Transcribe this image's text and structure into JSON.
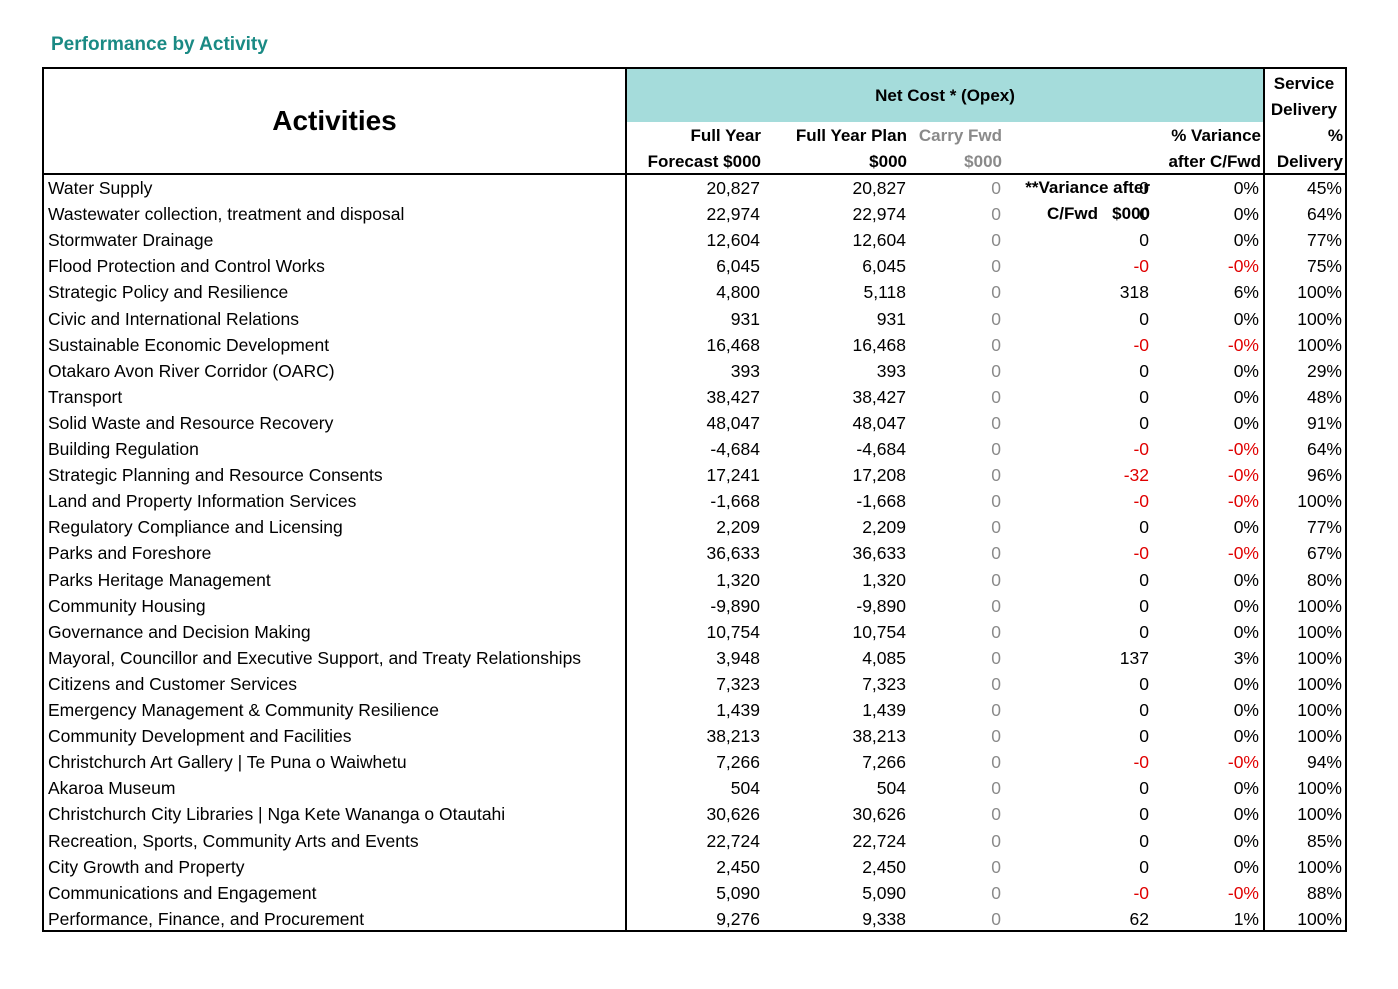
{
  "title": "Performance by Activity",
  "header": {
    "activities": "Activities",
    "net_cost": "Net Cost * (Opex)",
    "service_delivery": [
      "Service",
      "Delivery"
    ],
    "cols": [
      {
        "l1": "Full Year",
        "l2": "Forecast $000"
      },
      {
        "l1": "Full Year Plan",
        "l2": "$000"
      },
      {
        "l1": "Carry Fwd",
        "l2": "$000"
      },
      {
        "l1": "**Variance after",
        "l2": "C/Fwd   $000"
      },
      {
        "l1": "% Variance",
        "l2": "after C/Fwd"
      },
      {
        "l1": "%",
        "l2": "Delivery"
      }
    ]
  },
  "colors": {
    "title": "#1a8a84",
    "header_fill": "#a5dcdb",
    "negative": "#e00000",
    "muted": "#8a8a8a"
  },
  "rows": [
    {
      "name": "Water Supply",
      "forecast": "20,827",
      "plan": "20,827",
      "carry": "0",
      "variance": "0",
      "pct_var": "0%",
      "delivery": "45%"
    },
    {
      "name": "Wastewater collection, treatment and disposal",
      "forecast": "22,974",
      "plan": "22,974",
      "carry": "0",
      "variance": "0",
      "pct_var": "0%",
      "delivery": "64%"
    },
    {
      "name": "Stormwater Drainage",
      "forecast": "12,604",
      "plan": "12,604",
      "carry": "0",
      "variance": "0",
      "pct_var": "0%",
      "delivery": "77%"
    },
    {
      "name": "Flood Protection and Control Works",
      "forecast": "6,045",
      "plan": "6,045",
      "carry": "0",
      "variance": "-0",
      "pct_var": "-0%",
      "delivery": "75%"
    },
    {
      "name": "Strategic Policy and Resilience",
      "forecast": "4,800",
      "plan": "5,118",
      "carry": "0",
      "variance": "318",
      "pct_var": "6%",
      "delivery": "100%"
    },
    {
      "name": "Civic and International Relations",
      "forecast": "931",
      "plan": "931",
      "carry": "0",
      "variance": "0",
      "pct_var": "0%",
      "delivery": "100%"
    },
    {
      "name": "Sustainable Economic Development",
      "forecast": "16,468",
      "plan": "16,468",
      "carry": "0",
      "variance": "-0",
      "pct_var": "-0%",
      "delivery": "100%"
    },
    {
      "name": "Otakaro Avon River Corridor (OARC)",
      "forecast": "393",
      "plan": "393",
      "carry": "0",
      "variance": "0",
      "pct_var": "0%",
      "delivery": "29%"
    },
    {
      "name": "Transport",
      "forecast": "38,427",
      "plan": "38,427",
      "carry": "0",
      "variance": "0",
      "pct_var": "0%",
      "delivery": "48%"
    },
    {
      "name": "Solid Waste and Resource Recovery",
      "forecast": "48,047",
      "plan": "48,047",
      "carry": "0",
      "variance": "0",
      "pct_var": "0%",
      "delivery": "91%"
    },
    {
      "name": "Building Regulation",
      "forecast": "-4,684",
      "plan": "-4,684",
      "carry": "0",
      "variance": "-0",
      "pct_var": "-0%",
      "delivery": "64%"
    },
    {
      "name": "Strategic Planning and Resource Consents",
      "forecast": "17,241",
      "plan": "17,208",
      "carry": "0",
      "variance": "-32",
      "pct_var": "-0%",
      "delivery": "96%"
    },
    {
      "name": "Land and Property Information Services",
      "forecast": "-1,668",
      "plan": "-1,668",
      "carry": "0",
      "variance": "-0",
      "pct_var": "-0%",
      "delivery": "100%"
    },
    {
      "name": "Regulatory Compliance and Licensing",
      "forecast": "2,209",
      "plan": "2,209",
      "carry": "0",
      "variance": "0",
      "pct_var": "0%",
      "delivery": "77%"
    },
    {
      "name": "Parks and Foreshore",
      "forecast": "36,633",
      "plan": "36,633",
      "carry": "0",
      "variance": "-0",
      "pct_var": "-0%",
      "delivery": "67%"
    },
    {
      "name": "Parks Heritage Management",
      "forecast": "1,320",
      "plan": "1,320",
      "carry": "0",
      "variance": "0",
      "pct_var": "0%",
      "delivery": "80%"
    },
    {
      "name": "Community Housing",
      "forecast": "-9,890",
      "plan": "-9,890",
      "carry": "0",
      "variance": "0",
      "pct_var": "0%",
      "delivery": "100%"
    },
    {
      "name": "Governance and Decision Making",
      "forecast": "10,754",
      "plan": "10,754",
      "carry": "0",
      "variance": "0",
      "pct_var": "0%",
      "delivery": "100%"
    },
    {
      "name": "Mayoral, Councillor and Executive Support, and Treaty Relationships",
      "forecast": "3,948",
      "plan": "4,085",
      "carry": "0",
      "variance": "137",
      "pct_var": "3%",
      "delivery": "100%"
    },
    {
      "name": "Citizens and Customer Services",
      "forecast": "7,323",
      "plan": "7,323",
      "carry": "0",
      "variance": "0",
      "pct_var": "0%",
      "delivery": "100%"
    },
    {
      "name": "Emergency Management & Community Resilience",
      "forecast": "1,439",
      "plan": "1,439",
      "carry": "0",
      "variance": "0",
      "pct_var": "0%",
      "delivery": "100%"
    },
    {
      "name": "Community Development and Facilities",
      "forecast": "38,213",
      "plan": "38,213",
      "carry": "0",
      "variance": "0",
      "pct_var": "0%",
      "delivery": "100%"
    },
    {
      "name": "Christchurch Art Gallery | Te Puna o Waiwhetu",
      "forecast": "7,266",
      "plan": "7,266",
      "carry": "0",
      "variance": "-0",
      "pct_var": "-0%",
      "delivery": "94%"
    },
    {
      "name": "Akaroa Museum",
      "forecast": "504",
      "plan": "504",
      "carry": "0",
      "variance": "0",
      "pct_var": "0%",
      "delivery": "100%"
    },
    {
      "name": "Christchurch City Libraries | Nga Kete Wananga o Otautahi",
      "forecast": "30,626",
      "plan": "30,626",
      "carry": "0",
      "variance": "0",
      "pct_var": "0%",
      "delivery": "100%"
    },
    {
      "name": "Recreation, Sports, Community Arts and Events",
      "forecast": "22,724",
      "plan": "22,724",
      "carry": "0",
      "variance": "0",
      "pct_var": "0%",
      "delivery": "85%"
    },
    {
      "name": "City Growth and Property",
      "forecast": "2,450",
      "plan": "2,450",
      "carry": "0",
      "variance": "0",
      "pct_var": "0%",
      "delivery": "100%"
    },
    {
      "name": "Communications and Engagement",
      "forecast": "5,090",
      "plan": "5,090",
      "carry": "0",
      "variance": "-0",
      "pct_var": "-0%",
      "delivery": "88%"
    },
    {
      "name": "Performance, Finance, and Procurement",
      "forecast": "9,276",
      "plan": "9,338",
      "carry": "0",
      "variance": "62",
      "pct_var": "1%",
      "delivery": "100%"
    }
  ]
}
